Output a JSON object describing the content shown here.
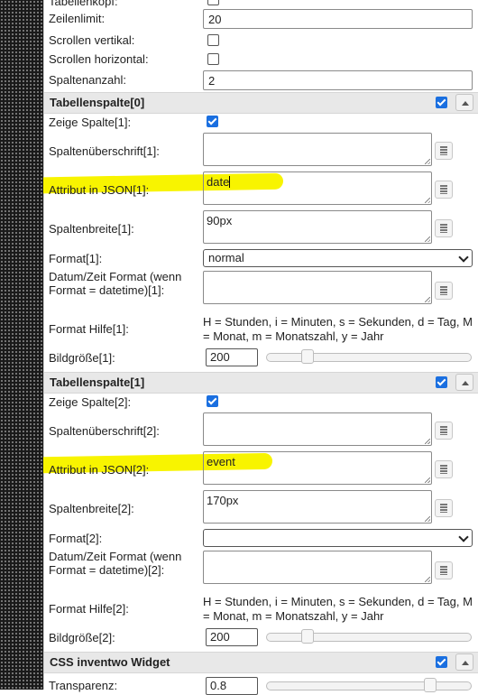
{
  "top_rows": [
    {
      "label": "Tabellenkopf:",
      "type": "checkbox",
      "checked": false
    },
    {
      "label": "Zeilenlimit:",
      "type": "input",
      "value": "20"
    },
    {
      "label": "Scrollen vertikal:",
      "type": "checkbox",
      "checked": false
    },
    {
      "label": "Scrollen horizontal:",
      "type": "checkbox",
      "checked": false
    },
    {
      "label": "Spaltenanzahl:",
      "type": "input",
      "value": "2"
    }
  ],
  "sections": [
    {
      "title": "Tabellenspalte[0]",
      "enabled": true,
      "show_label": "Zeige Spalte[1]:",
      "show_checked": true,
      "header_label": "Spaltenüberschrift[1]:",
      "header_value": "",
      "attr_label": "Attribut in JSON[1]:",
      "attr_value": "date",
      "width_label": "Spaltenbreite[1]:",
      "width_value": "90px",
      "format_label": "Format[1]:",
      "format_value": "normal",
      "datetime_label": "Datum/Zeit Format (wenn Format = datetime)[1]:",
      "datetime_value": "",
      "help_label": "Format Hilfe[1]:",
      "help_text": "H = Stunden, i = Minuten, s = Sekunden, d = Tag, M = Monat, m = Monatszahl, y = Jahr",
      "img_label": "Bildgröße[1]:",
      "img_value": "200",
      "img_slider_fraction": 0.2
    },
    {
      "title": "Tabellenspalte[1]",
      "enabled": true,
      "show_label": "Zeige Spalte[2]:",
      "show_checked": true,
      "header_label": "Spaltenüberschrift[2]:",
      "header_value": "",
      "attr_label": "Attribut in JSON[2]:",
      "attr_value": "event",
      "width_label": "Spaltenbreite[2]:",
      "width_value": "170px",
      "format_label": "Format[2]:",
      "format_value": "",
      "datetime_label": "Datum/Zeit Format (wenn Format = datetime)[2]:",
      "datetime_value": "",
      "help_label": "Format Hilfe[2]:",
      "help_text": "H = Stunden, i = Minuten, s = Sekunden, d = Tag, M = Monat, m = Monatszahl, y = Jahr",
      "img_label": "Bildgröße[2]:",
      "img_value": "200",
      "img_slider_fraction": 0.2
    }
  ],
  "css_section": {
    "title": "CSS inventwo Widget",
    "enabled": true,
    "transparency_label": "Transparenz:",
    "transparency_value": "0.8",
    "transparency_fraction": 0.8
  },
  "colors": {
    "highlight": "#f8f400",
    "accent": "#1a6fe0"
  }
}
